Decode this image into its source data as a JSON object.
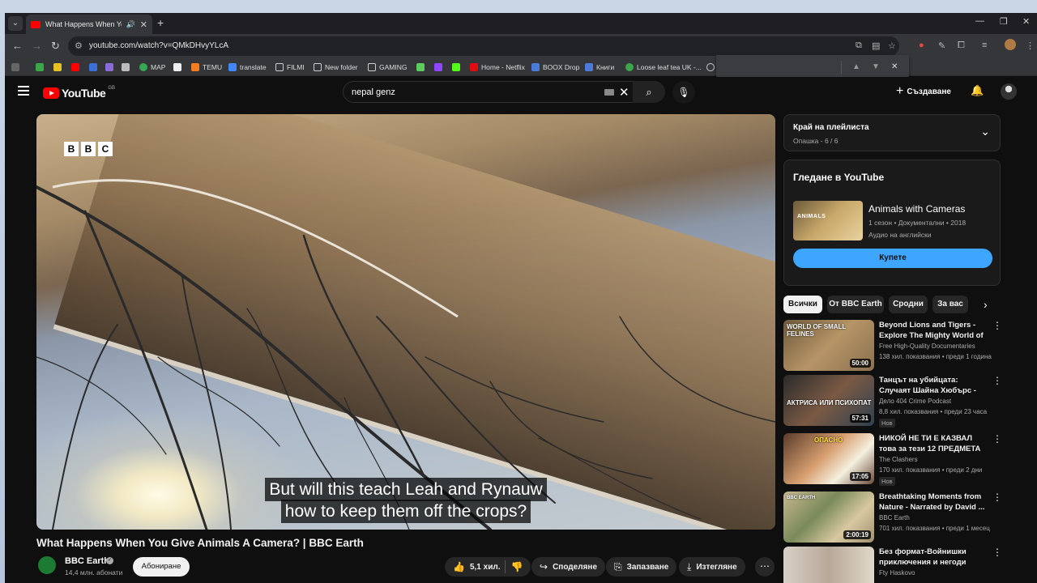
{
  "browser": {
    "tab_title": "What Happens When You Give Animals A Camera? | BBC Earth",
    "url": "youtube.com/watch?v=QMkDHvyYLcA",
    "bookmarks": [
      "MAP",
      "TEMU",
      "translate",
      "FILMI",
      "New folder",
      "GAMING",
      "Home - Netflix",
      "BOOX Drop",
      "Книги",
      "Loose leaf tea UK -..."
    ]
  },
  "header": {
    "logo": "YouTube",
    "country": "GB",
    "search_query": "nepal genz",
    "create_label": "Създаване"
  },
  "player": {
    "bbc_letters": [
      "B",
      "B",
      "C"
    ],
    "subtitle_lines": [
      "But will this teach Leah and Rynauw",
      "how to keep them off the crops?"
    ]
  },
  "video": {
    "title": "What Happens When You Give Animals A Camera? | BBC Earth",
    "channel": "BBC Earth",
    "subscribers": "14,4 млн. абонати",
    "subscribe_label": "Абониране",
    "likes": "5,1 хил.",
    "share_label": "Споделяне",
    "save_label": "Запазване",
    "download_label": "Изтегляне"
  },
  "playlist": {
    "title": "Край на плейлиста",
    "subtitle": "Опашка - 6 / 6"
  },
  "watch_card": {
    "heading": "Гледане в YouTube",
    "name": "Animals with Cameras",
    "thumb_text": "ANIMALS",
    "meta1": "1 сезон • Документални • 2018",
    "meta2": "Аудио на английски",
    "buy_label": "Купете"
  },
  "chips": [
    "Всички",
    "От BBC Earth",
    "Сродни",
    "За вас"
  ],
  "recommendations": [
    {
      "title": "Beyond Lions and Tigers - Explore The Mighty World of ...",
      "channel": "Free High-Quality Documentaries",
      "views": "138 хил. показвания • преди 1 година",
      "duration": "50:00",
      "thumb_text": "WORLD OF SMALL FELINES",
      "badge": ""
    },
    {
      "title": "Танцът на убийцата: Случаят Шайна Хюбърс - Дело 404 ...",
      "channel": "Дело 404 Crime Podcast",
      "views": "8,8 хил. показвания • преди 23 часа",
      "duration": "57:31",
      "thumb_text": "АКТРИСА ИЛИ ПСИХОПАТ",
      "badge": "Нов"
    },
    {
      "title": "НИКОЙ НЕ ТИ Е КАЗВАЛ това за тези 12 ПРЕДМЕТА",
      "channel": "The Clashers",
      "views": "170 хил. показвания • преди 2 дни",
      "duration": "17:05",
      "thumb_text": "ОПАСНО",
      "badge": "Нов"
    },
    {
      "title": "Breathtaking Moments from Nature - Narrated by David ...",
      "channel": "BBC Earth",
      "views": "701 хил. показвания • преди 1 месец",
      "duration": "2:00:19",
      "thumb_text": "BBC EARTH",
      "badge": ""
    },
    {
      "title": "Без формат-Войнишки приключения и негоди",
      "channel": "Fty Haskovo",
      "views": "",
      "duration": "",
      "thumb_text": "",
      "badge": ""
    }
  ],
  "colors": {
    "yt_red": "#ff0000",
    "accent_blue": "#3ea6ff",
    "background": "#0f0f0f"
  }
}
